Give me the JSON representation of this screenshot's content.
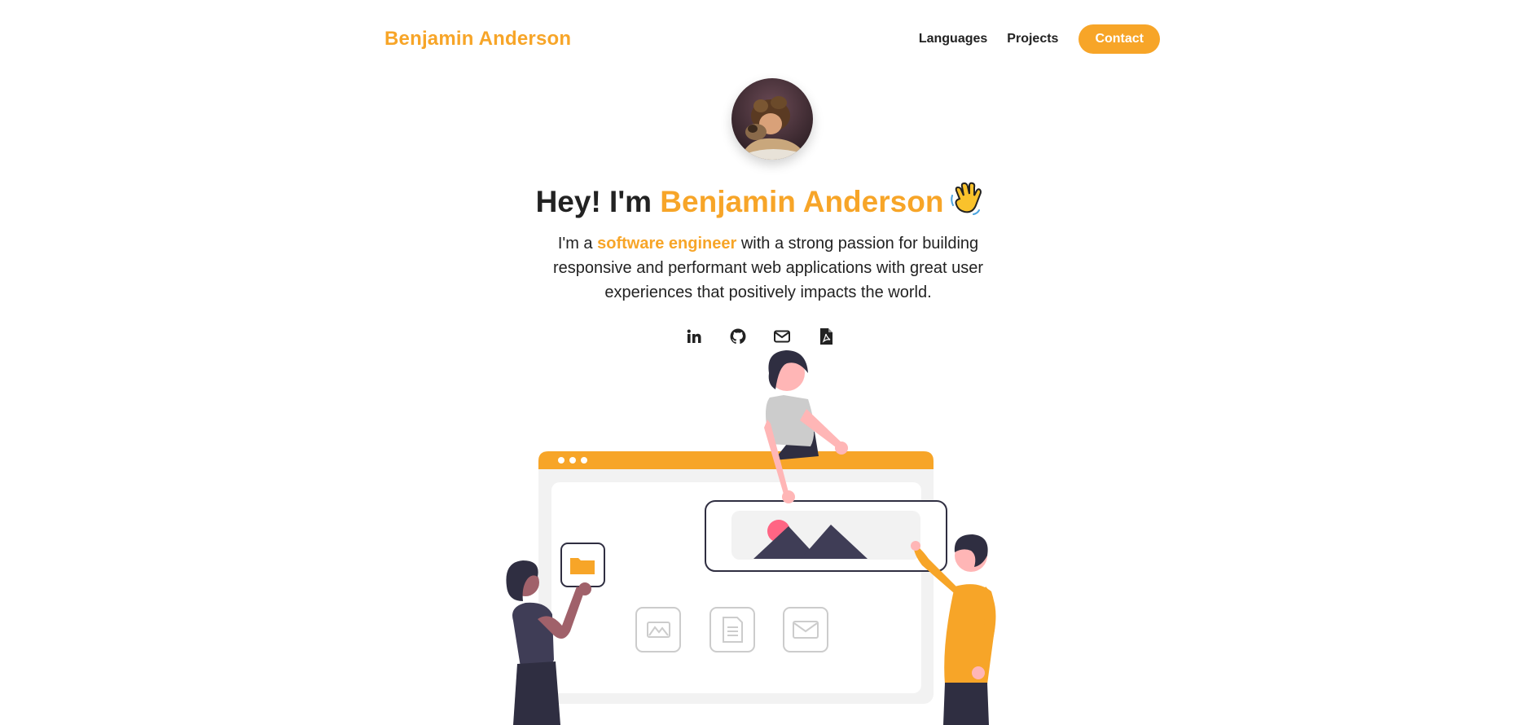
{
  "nav": {
    "brand": "Benjamin Anderson",
    "links": [
      "Languages",
      "Projects"
    ],
    "contact": "Contact"
  },
  "hero": {
    "greeting": "Hey! I'm ",
    "name": "Benjamin Anderson",
    "text_before": "I'm a ",
    "highlight": "software engineer",
    "text_after": " with a strong passion for building responsive and performant web applications with great user experiences that positively impacts the world."
  },
  "socials": [
    "linkedin-icon",
    "github-icon",
    "mail-icon",
    "pdf-icon"
  ],
  "colors": {
    "accent": "#f7a528",
    "text": "#222222",
    "dark_figure": "#2f2e41",
    "skin": "#ffb6b6"
  }
}
